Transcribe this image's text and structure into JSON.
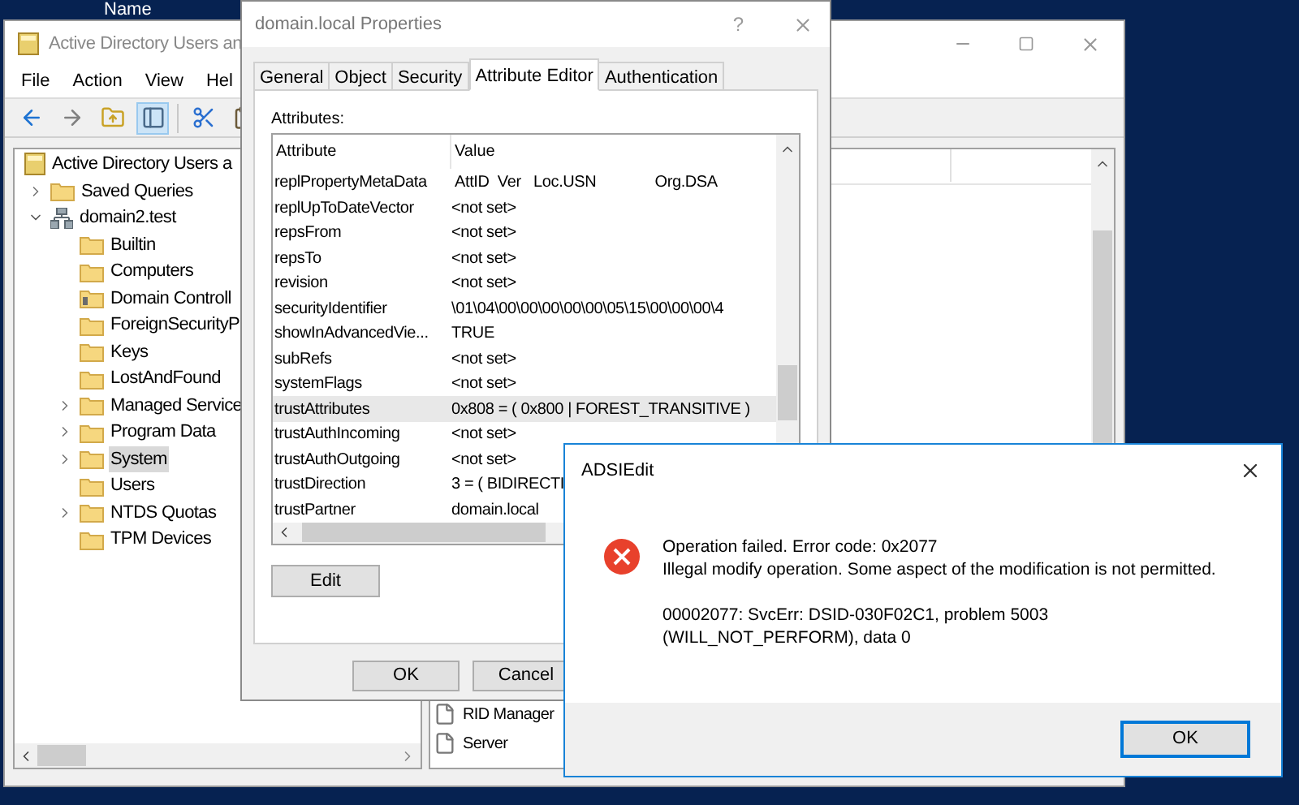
{
  "background_window": {
    "column_header": "Name"
  },
  "main_window": {
    "title": "Active Directory Users an",
    "menu": [
      "File",
      "Action",
      "View",
      "Hel"
    ],
    "toolbar": [
      {
        "kind": "back",
        "pressed": false
      },
      {
        "kind": "forward",
        "pressed": false
      },
      {
        "kind": "up",
        "pressed": false
      },
      {
        "kind": "tree",
        "pressed": true
      },
      {
        "kind": "cut",
        "pressed": false
      },
      {
        "kind": "paste",
        "pressed": false
      }
    ],
    "tree": [
      {
        "label": "Active Directory Users a",
        "kind": "root",
        "selected": false,
        "children": [
          {
            "label": "Saved Queries",
            "kind": "folder",
            "expanded": false,
            "selected": false
          },
          {
            "label": "domain2.test",
            "kind": "domain",
            "expanded": true,
            "selected": false,
            "children": [
              {
                "label": "Builtin",
                "kind": "folder",
                "selected": false
              },
              {
                "label": "Computers",
                "kind": "folder",
                "selected": false
              },
              {
                "label": "Domain Controll",
                "kind": "dc",
                "selected": false
              },
              {
                "label": "ForeignSecurityP",
                "kind": "folder",
                "selected": false
              },
              {
                "label": "Keys",
                "kind": "folder",
                "selected": false
              },
              {
                "label": "LostAndFound",
                "kind": "folder",
                "selected": false
              },
              {
                "label": "Managed Service",
                "kind": "folder",
                "expanded": false,
                "selected": false
              },
              {
                "label": "Program Data",
                "kind": "folder",
                "expanded": false,
                "selected": false
              },
              {
                "label": "System",
                "kind": "folder",
                "expanded": false,
                "selected": true
              },
              {
                "label": "Users",
                "kind": "folder",
                "selected": false
              },
              {
                "label": "NTDS Quotas",
                "kind": "folder",
                "expanded": false,
                "selected": false
              },
              {
                "label": "TPM Devices",
                "kind": "folder",
                "selected": false
              }
            ]
          }
        ]
      }
    ],
    "list_items": [
      "RID Manager",
      "Server"
    ]
  },
  "properties_dialog": {
    "title": "domain.local Properties",
    "help": "?",
    "tabs": [
      {
        "label": "General",
        "selected": false
      },
      {
        "label": "Object",
        "selected": false
      },
      {
        "label": "Security",
        "selected": false
      },
      {
        "label": "Attribute Editor",
        "selected": true
      },
      {
        "label": "Authentication",
        "selected": false
      }
    ],
    "attributes_label": "Attributes:",
    "columns": [
      "Attribute",
      "Value"
    ],
    "rows": [
      {
        "attribute": "replPropertyMetaData",
        "value": " AttID  Ver   Loc.USN              Org.DSA",
        "selected": false
      },
      {
        "attribute": "replUpToDateVector",
        "value": "<not set>",
        "selected": false
      },
      {
        "attribute": "repsFrom",
        "value": "<not set>",
        "selected": false
      },
      {
        "attribute": "repsTo",
        "value": "<not set>",
        "selected": false
      },
      {
        "attribute": "revision",
        "value": "<not set>",
        "selected": false
      },
      {
        "attribute": "securityIdentifier",
        "value": "\\01\\04\\00\\00\\00\\00\\00\\05\\15\\00\\00\\00\\4",
        "selected": false
      },
      {
        "attribute": "showInAdvancedVie...",
        "value": "TRUE",
        "selected": false
      },
      {
        "attribute": "subRefs",
        "value": "<not set>",
        "selected": false
      },
      {
        "attribute": "systemFlags",
        "value": "<not set>",
        "selected": false
      },
      {
        "attribute": "trustAttributes",
        "value": "0x808 = ( 0x800 | FOREST_TRANSITIVE )",
        "selected": true
      },
      {
        "attribute": "trustAuthIncoming",
        "value": "<not set>",
        "selected": false
      },
      {
        "attribute": "trustAuthOutgoing",
        "value": "<not set>",
        "selected": false
      },
      {
        "attribute": "trustDirection",
        "value": "3 = ( BIDIRECTI",
        "selected": false
      },
      {
        "attribute": "trustPartner",
        "value": "domain.local",
        "selected": false
      }
    ],
    "edit_button": "Edit",
    "buttons": [
      "OK",
      "Cancel"
    ]
  },
  "error_dialog": {
    "title": "ADSIEdit",
    "message_lines": [
      "Operation failed. Error code: 0x2077",
      "Illegal modify operation. Some aspect of the modification is not permitted."
    ],
    "detail": "00002077: SvcErr: DSID-030F02C1, problem 5003 (WILL_NOT_PERFORM), data 0",
    "button": "OK"
  }
}
